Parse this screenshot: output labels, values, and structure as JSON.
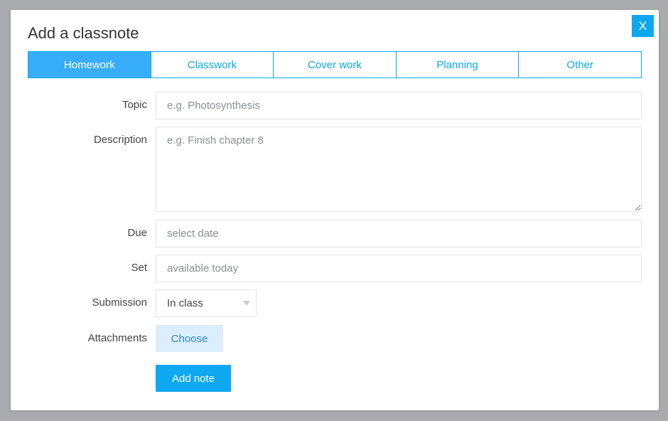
{
  "modal": {
    "title": "Add a classnote",
    "close_label": "X"
  },
  "tabs": [
    {
      "label": "Homework",
      "active": true
    },
    {
      "label": "Classwork",
      "active": false
    },
    {
      "label": "Cover work",
      "active": false
    },
    {
      "label": "Planning",
      "active": false
    },
    {
      "label": "Other",
      "active": false
    }
  ],
  "form": {
    "topic": {
      "label": "Topic",
      "placeholder": "e.g. Photosynthesis",
      "value": ""
    },
    "description": {
      "label": "Description",
      "placeholder": "e.g. Finish chapter 8",
      "value": ""
    },
    "due": {
      "label": "Due",
      "placeholder": "select date",
      "value": ""
    },
    "set": {
      "label": "Set",
      "placeholder": "available today",
      "value": ""
    },
    "submission": {
      "label": "Submission",
      "value": "In class"
    },
    "attachments": {
      "label": "Attachments",
      "button_label": "Choose"
    },
    "submit_label": "Add note"
  },
  "colors": {
    "accent": "#0da8f0",
    "active_tab": "#37adf7",
    "choose_bg": "#dcedfb",
    "overlay": "#a9abae"
  }
}
